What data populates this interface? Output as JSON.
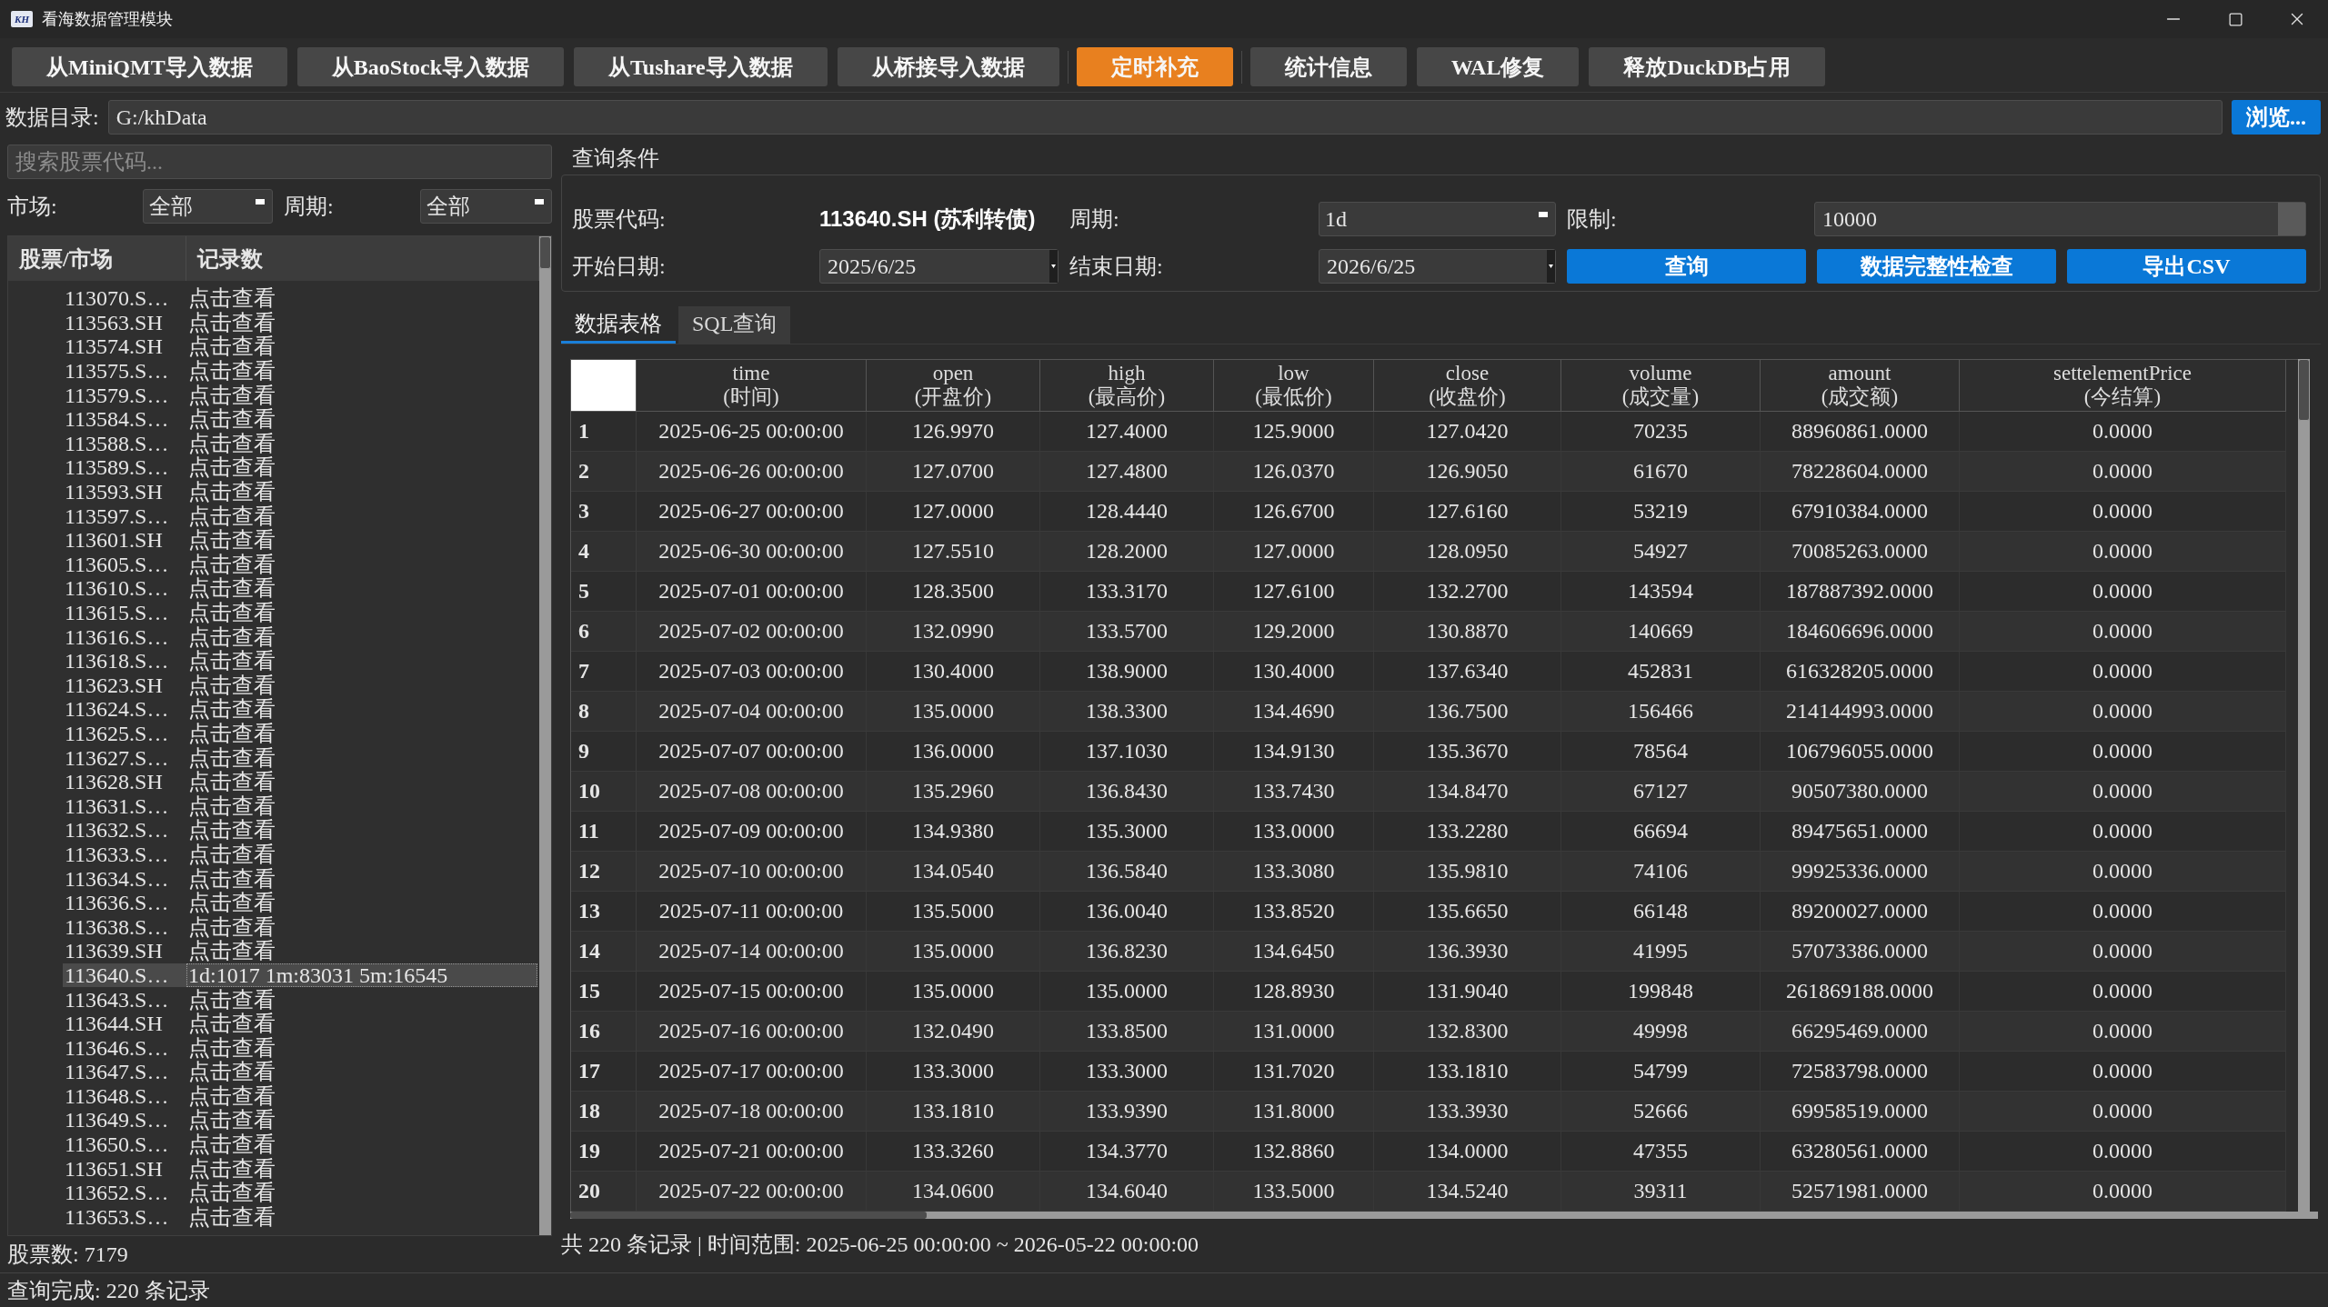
{
  "window": {
    "logo": "KH",
    "title": "看海数据管理模块"
  },
  "toolbar": {
    "groups": [
      {
        "buttons": [
          {
            "label": "从MiniQMT导入数据",
            "active": false
          },
          {
            "label": "从BaoStock导入数据",
            "active": false
          },
          {
            "label": "从Tushare导入数据",
            "active": false
          },
          {
            "label": "从桥接导入数据",
            "active": false
          }
        ]
      },
      {
        "buttons": [
          {
            "label": "定时补充",
            "active": true
          }
        ]
      },
      {
        "buttons": [
          {
            "label": "统计信息",
            "active": false
          },
          {
            "label": "WAL修复",
            "active": false
          },
          {
            "label": "释放DuckDB占用",
            "active": false
          }
        ]
      }
    ]
  },
  "data_dir": {
    "label": "数据目录:",
    "value": "G:/khData",
    "browse_button": "浏览..."
  },
  "stock_panel": {
    "search": {
      "placeholder": "搜索股票代码..."
    },
    "filters": [
      {
        "label": "市场:",
        "value": "全部"
      },
      {
        "label": "周期:",
        "value": "全部"
      }
    ],
    "tree": {
      "columns": [
        "股票/市场",
        "记录数"
      ],
      "rows": [
        {
          "code": "113070.S…",
          "records": "点击查看",
          "selected": false
        },
        {
          "code": "113563.SH",
          "records": "点击查看",
          "selected": false
        },
        {
          "code": "113574.SH",
          "records": "点击查看",
          "selected": false
        },
        {
          "code": "113575.S…",
          "records": "点击查看",
          "selected": false
        },
        {
          "code": "113579.S…",
          "records": "点击查看",
          "selected": false
        },
        {
          "code": "113584.S…",
          "records": "点击查看",
          "selected": false
        },
        {
          "code": "113588.S…",
          "records": "点击查看",
          "selected": false
        },
        {
          "code": "113589.S…",
          "records": "点击查看",
          "selected": false
        },
        {
          "code": "113593.SH",
          "records": "点击查看",
          "selected": false
        },
        {
          "code": "113597.S…",
          "records": "点击查看",
          "selected": false
        },
        {
          "code": "113601.SH",
          "records": "点击查看",
          "selected": false
        },
        {
          "code": "113605.S…",
          "records": "点击查看",
          "selected": false
        },
        {
          "code": "113610.S…",
          "records": "点击查看",
          "selected": false
        },
        {
          "code": "113615.S…",
          "records": "点击查看",
          "selected": false
        },
        {
          "code": "113616.S…",
          "records": "点击查看",
          "selected": false
        },
        {
          "code": "113618.S…",
          "records": "点击查看",
          "selected": false
        },
        {
          "code": "113623.SH",
          "records": "点击查看",
          "selected": false
        },
        {
          "code": "113624.S…",
          "records": "点击查看",
          "selected": false
        },
        {
          "code": "113625.S…",
          "records": "点击查看",
          "selected": false
        },
        {
          "code": "113627.S…",
          "records": "点击查看",
          "selected": false
        },
        {
          "code": "113628.SH",
          "records": "点击查看",
          "selected": false
        },
        {
          "code": "113631.S…",
          "records": "点击查看",
          "selected": false
        },
        {
          "code": "113632.S…",
          "records": "点击查看",
          "selected": false
        },
        {
          "code": "113633.S…",
          "records": "点击查看",
          "selected": false
        },
        {
          "code": "113634.S…",
          "records": "点击查看",
          "selected": false
        },
        {
          "code": "113636.S…",
          "records": "点击查看",
          "selected": false
        },
        {
          "code": "113638.S…",
          "records": "点击查看",
          "selected": false
        },
        {
          "code": "113639.SH",
          "records": "点击查看",
          "selected": false
        },
        {
          "code": "113640.S…",
          "records": "1d:1017 1m:83031 5m:16545",
          "selected": true
        },
        {
          "code": "113643.S…",
          "records": "点击查看",
          "selected": false
        },
        {
          "code": "113644.SH",
          "records": "点击查看",
          "selected": false
        },
        {
          "code": "113646.S…",
          "records": "点击查看",
          "selected": false
        },
        {
          "code": "113647.S…",
          "records": "点击查看",
          "selected": false
        },
        {
          "code": "113648.S…",
          "records": "点击查看",
          "selected": false
        },
        {
          "code": "113649.S…",
          "records": "点击查看",
          "selected": false
        },
        {
          "code": "113650.S…",
          "records": "点击查看",
          "selected": false
        },
        {
          "code": "113651.SH",
          "records": "点击查看",
          "selected": false
        },
        {
          "code": "113652.S…",
          "records": "点击查看",
          "selected": false
        },
        {
          "code": "113653.S…",
          "records": "点击查看",
          "selected": false
        }
      ]
    },
    "count": "股票数: 7179"
  },
  "query": {
    "title": "查询条件",
    "stock_code": {
      "label": "股票代码:",
      "value": "113640.SH (苏利转债)"
    },
    "period": {
      "label": "周期:",
      "value": "1d"
    },
    "limit": {
      "label": "限制:",
      "value": "10000"
    },
    "start_date": {
      "label": "开始日期:",
      "value": "2025/6/25"
    },
    "end_date": {
      "label": "结束日期:",
      "value": "2026/6/25"
    },
    "buttons": [
      "查询",
      "数据完整性检查",
      "导出CSV"
    ]
  },
  "tabs": [
    {
      "label": "数据表格",
      "selected": true
    },
    {
      "label": "SQL查询",
      "selected": false
    }
  ],
  "table": {
    "columns": [
      {
        "field": "time",
        "caption": "(时间)"
      },
      {
        "field": "open",
        "caption": "(开盘价)"
      },
      {
        "field": "high",
        "caption": "(最高价)"
      },
      {
        "field": "low",
        "caption": "(最低价)"
      },
      {
        "field": "close",
        "caption": "(收盘价)"
      },
      {
        "field": "volume",
        "caption": "(成交量)"
      },
      {
        "field": "amount",
        "caption": "(成交额)"
      },
      {
        "field": "settelementPrice",
        "caption": "(今结算)"
      }
    ],
    "rows": [
      {
        "index": "1",
        "cells": [
          "2025-06-25 00:00:00",
          "126.9970",
          "127.4000",
          "125.9000",
          "127.0420",
          "70235",
          "88960861.0000",
          "0.0000"
        ]
      },
      {
        "index": "2",
        "cells": [
          "2025-06-26 00:00:00",
          "127.0700",
          "127.4800",
          "126.0370",
          "126.9050",
          "61670",
          "78228604.0000",
          "0.0000"
        ]
      },
      {
        "index": "3",
        "cells": [
          "2025-06-27 00:00:00",
          "127.0000",
          "128.4440",
          "126.6700",
          "127.6160",
          "53219",
          "67910384.0000",
          "0.0000"
        ]
      },
      {
        "index": "4",
        "cells": [
          "2025-06-30 00:00:00",
          "127.5510",
          "128.2000",
          "127.0000",
          "128.0950",
          "54927",
          "70085263.0000",
          "0.0000"
        ]
      },
      {
        "index": "5",
        "cells": [
          "2025-07-01 00:00:00",
          "128.3500",
          "133.3170",
          "127.6100",
          "132.2700",
          "143594",
          "187887392.0000",
          "0.0000"
        ]
      },
      {
        "index": "6",
        "cells": [
          "2025-07-02 00:00:00",
          "132.0990",
          "133.5700",
          "129.2000",
          "130.8870",
          "140669",
          "184606696.0000",
          "0.0000"
        ]
      },
      {
        "index": "7",
        "cells": [
          "2025-07-03 00:00:00",
          "130.4000",
          "138.9000",
          "130.4000",
          "137.6340",
          "452831",
          "616328205.0000",
          "0.0000"
        ]
      },
      {
        "index": "8",
        "cells": [
          "2025-07-04 00:00:00",
          "135.0000",
          "138.3300",
          "134.4690",
          "136.7500",
          "156466",
          "214144993.0000",
          "0.0000"
        ]
      },
      {
        "index": "9",
        "cells": [
          "2025-07-07 00:00:00",
          "136.0000",
          "137.1030",
          "134.9130",
          "135.3670",
          "78564",
          "106796055.0000",
          "0.0000"
        ]
      },
      {
        "index": "10",
        "cells": [
          "2025-07-08 00:00:00",
          "135.2960",
          "136.8430",
          "133.7430",
          "134.8470",
          "67127",
          "90507380.0000",
          "0.0000"
        ]
      },
      {
        "index": "11",
        "cells": [
          "2025-07-09 00:00:00",
          "134.9380",
          "135.3000",
          "133.0000",
          "133.2280",
          "66694",
          "89475651.0000",
          "0.0000"
        ]
      },
      {
        "index": "12",
        "cells": [
          "2025-07-10 00:00:00",
          "134.0540",
          "136.5840",
          "133.3080",
          "135.9810",
          "74106",
          "99925336.0000",
          "0.0000"
        ]
      },
      {
        "index": "13",
        "cells": [
          "2025-07-11 00:00:00",
          "135.5000",
          "136.0040",
          "133.8520",
          "135.6650",
          "66148",
          "89200027.0000",
          "0.0000"
        ]
      },
      {
        "index": "14",
        "cells": [
          "2025-07-14 00:00:00",
          "135.0000",
          "136.8230",
          "134.6450",
          "136.3930",
          "41995",
          "57073386.0000",
          "0.0000"
        ]
      },
      {
        "index": "15",
        "cells": [
          "2025-07-15 00:00:00",
          "135.0000",
          "135.0000",
          "128.8930",
          "131.9040",
          "199848",
          "261869188.0000",
          "0.0000"
        ]
      },
      {
        "index": "16",
        "cells": [
          "2025-07-16 00:00:00",
          "132.0490",
          "133.8500",
          "131.0000",
          "132.8300",
          "49998",
          "66295469.0000",
          "0.0000"
        ]
      },
      {
        "index": "17",
        "cells": [
          "2025-07-17 00:00:00",
          "133.3000",
          "133.3000",
          "131.7020",
          "133.1810",
          "54799",
          "72583798.0000",
          "0.0000"
        ]
      },
      {
        "index": "18",
        "cells": [
          "2025-07-18 00:00:00",
          "133.1810",
          "133.9390",
          "131.8000",
          "133.3930",
          "52666",
          "69958519.0000",
          "0.0000"
        ]
      },
      {
        "index": "19",
        "cells": [
          "2025-07-21 00:00:00",
          "133.3260",
          "134.3770",
          "132.8860",
          "134.0000",
          "47355",
          "63280561.0000",
          "0.0000"
        ]
      },
      {
        "index": "20",
        "cells": [
          "2025-07-22 00:00:00",
          "134.0600",
          "134.6040",
          "133.5000",
          "134.5240",
          "39311",
          "52571981.0000",
          "0.0000"
        ]
      }
    ]
  },
  "table_footer": "共 220 条记录 | 时间范围: 2025-06-25 00:00:00 ~ 2026-05-22 00:00:00",
  "status_bar": "查询完成: 220 条记录"
}
